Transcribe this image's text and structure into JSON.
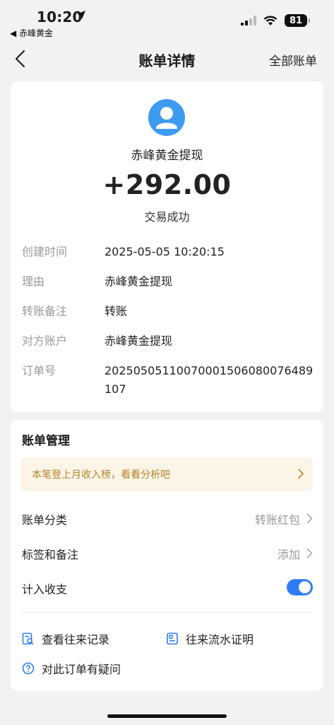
{
  "status_bar": {
    "time": "10:20",
    "back_app": "◀ 赤峰黄金",
    "battery": "81"
  },
  "nav": {
    "title": "账单详情",
    "right_label": "全部账单"
  },
  "transaction": {
    "payee": "赤峰黄金提现",
    "amount": "+292.00",
    "status": "交易成功",
    "details": [
      {
        "key": "创建时间",
        "value": "2025-05-05 10:20:15"
      },
      {
        "key": "理由",
        "value": "赤峰黄金提现"
      },
      {
        "key": "转账备注",
        "value": "转账"
      },
      {
        "key": "对方账户",
        "value": "赤峰黄金提现"
      },
      {
        "key": "订单号",
        "value": "20250505110070001506080076489107"
      }
    ]
  },
  "management": {
    "title": "账单管理",
    "banner": "本笔登上月收入榜，看看分析吧",
    "category_label": "账单分类",
    "category_value": "转账红包",
    "tags_label": "标签和备注",
    "tags_value": "添加",
    "include_label": "计入收支",
    "include_on": true,
    "link_records": "查看往来记录",
    "link_statement": "往来流水证明",
    "link_question": "对此订单有疑问"
  },
  "colors": {
    "accent": "#2f7cf6",
    "avatar": "#3d9bef",
    "banner_bg": "#fbf5e8",
    "banner_text": "#b5832b"
  },
  "icons": [
    "location-arrow-icon",
    "signal-icon",
    "wifi-icon",
    "battery-icon",
    "back-chevron-icon",
    "user-avatar-icon",
    "chevron-right-icon",
    "records-search-icon",
    "statement-icon",
    "question-icon"
  ]
}
